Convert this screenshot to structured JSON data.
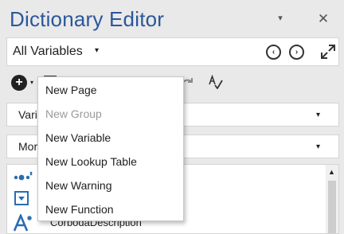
{
  "window": {
    "title": "Dictionary Editor",
    "pin_glyph": "▾",
    "close_glyph": "✕"
  },
  "scope": {
    "selected": "All Variables",
    "caret": "▾",
    "nav_back_glyph": "‹",
    "nav_forward_glyph": "›"
  },
  "toolbar": {
    "add_glyph": "+",
    "add_caret": "▾"
  },
  "filters": [
    {
      "label": "Vari",
      "caret": "▾"
    },
    {
      "label": "Mor",
      "caret": "▾"
    }
  ],
  "list": {
    "items": [
      {
        "icon": "dots-variable-icon",
        "label": ""
      },
      {
        "icon": "dropdown-variable-icon",
        "label": ""
      },
      {
        "icon": "text-variable-icon",
        "label": "CorbodaDescription"
      }
    ],
    "scroll_up_glyph": "▲"
  },
  "menu": {
    "items": [
      {
        "label": "New Page",
        "enabled": true
      },
      {
        "label": "New Group",
        "enabled": false
      },
      {
        "label": "New Variable",
        "enabled": true
      },
      {
        "label": "New Lookup Table",
        "enabled": true
      },
      {
        "label": "New Warning",
        "enabled": true
      },
      {
        "label": "New Function",
        "enabled": true
      }
    ]
  },
  "colors": {
    "title": "#2b579a",
    "icon_blue": "#2b6cb0",
    "disabled_text": "#9a9a9a",
    "background": "#e9e9e9"
  }
}
